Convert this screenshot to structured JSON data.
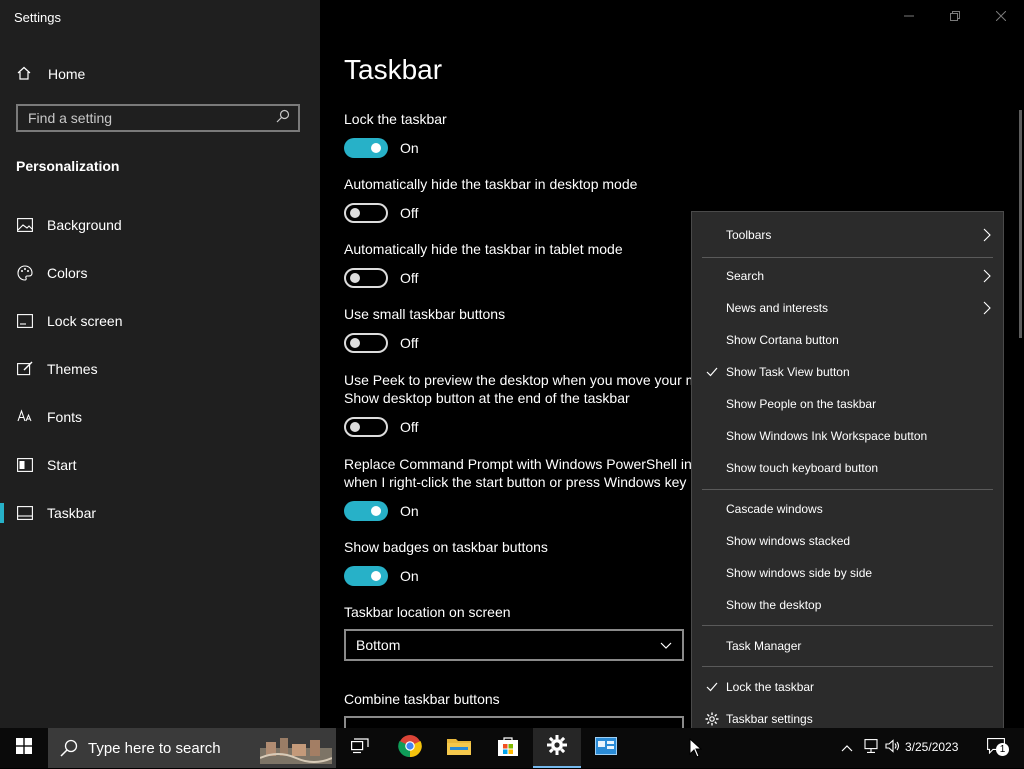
{
  "window": {
    "title": "Settings"
  },
  "sidebar": {
    "home_label": "Home",
    "search_placeholder": "Find a setting",
    "section_title": "Personalization",
    "items": [
      {
        "label": "Background",
        "icon": "picture-icon"
      },
      {
        "label": "Colors",
        "icon": "palette-icon"
      },
      {
        "label": "Lock screen",
        "icon": "lock-screen-icon"
      },
      {
        "label": "Themes",
        "icon": "themes-icon"
      },
      {
        "label": "Fonts",
        "icon": "fonts-icon"
      },
      {
        "label": "Start",
        "icon": "start-icon"
      },
      {
        "label": "Taskbar",
        "icon": "taskbar-icon",
        "active": true
      }
    ]
  },
  "main": {
    "title": "Taskbar",
    "settings": [
      {
        "label": "Lock the taskbar",
        "state": "On"
      },
      {
        "label": "Automatically hide the taskbar in desktop mode",
        "state": "Off"
      },
      {
        "label": "Automatically hide the taskbar in tablet mode",
        "state": "Off"
      },
      {
        "label": "Use small taskbar buttons",
        "state": "Off"
      },
      {
        "label_line1": "Use Peek to preview the desktop when you move your m",
        "label_line2": "Show desktop button at the end of the taskbar",
        "state": "Off"
      },
      {
        "label_line1": "Replace Command Prompt with Windows PowerShell in t",
        "label_line2": "when I right-click the start button or press Windows key",
        "state": "On"
      },
      {
        "label": "Show badges on taskbar buttons",
        "state": "On"
      }
    ],
    "location_label": "Taskbar location on screen",
    "location_value": "Bottom",
    "combine_label": "Combine taskbar buttons"
  },
  "context_menu": {
    "items": [
      {
        "label": "Toolbars",
        "submenu": true
      },
      {
        "label": "Search",
        "submenu": true
      },
      {
        "label": "News and interests",
        "submenu": true
      },
      {
        "label": "Show Cortana button"
      },
      {
        "label": "Show Task View button",
        "checked": true
      },
      {
        "label": "Show People on the taskbar"
      },
      {
        "label": "Show Windows Ink Workspace button"
      },
      {
        "label": "Show touch keyboard button"
      },
      {
        "label": "Cascade windows"
      },
      {
        "label": "Show windows stacked"
      },
      {
        "label": "Show windows side by side"
      },
      {
        "label": "Show the desktop"
      },
      {
        "label": "Task Manager"
      },
      {
        "label": "Lock the taskbar",
        "checked": true
      },
      {
        "label": "Taskbar settings",
        "icon": "gear-icon"
      }
    ]
  },
  "taskbar": {
    "search_placeholder": "Type here to search",
    "date": "3/25/2023",
    "notification_count": "1"
  },
  "colors": {
    "accent": "#27b1c8",
    "sidebar_bg": "#1f1f1f",
    "menu_bg": "#2b2b2b"
  }
}
